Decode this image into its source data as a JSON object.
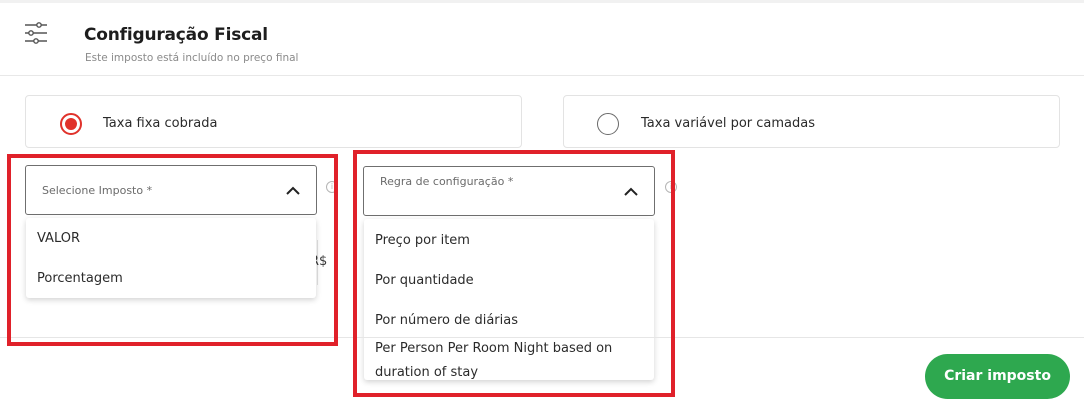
{
  "header": {
    "title": "Configuração Fiscal",
    "subtitle": "Este imposto está incluído no preço final",
    "icon": "sliders-icon"
  },
  "tax_type_options": [
    {
      "label": "Taxa fixa cobrada",
      "selected": true
    },
    {
      "label": "Taxa variável por camadas",
      "selected": false
    }
  ],
  "tax_select": {
    "placeholder": "Selecione Imposto *",
    "expanded": true,
    "options": [
      "VALOR",
      "Porcentagem"
    ]
  },
  "config_rule_select": {
    "placeholder": "Regra de configuração *",
    "expanded": true,
    "options": [
      "Preço por item",
      "Por quantidade",
      "Por número de diárias",
      "Per Person Per Room Night based on",
      "duration of stay"
    ]
  },
  "background_field": {
    "currency_suffix": "R$"
  },
  "footer": {
    "create_button": "Criar imposto"
  },
  "colors": {
    "accent_red": "#e0322b",
    "highlight_red": "#e0212a",
    "primary_green": "#2ea84f"
  }
}
